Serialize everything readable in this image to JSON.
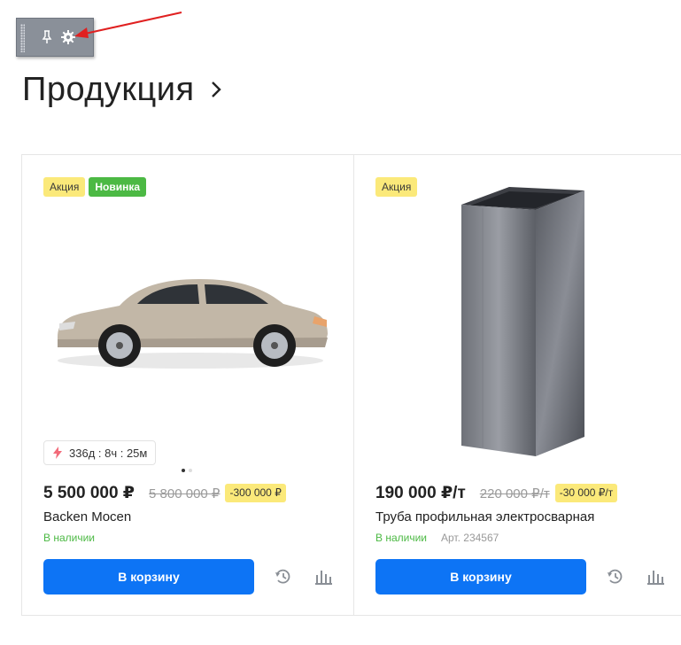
{
  "page": {
    "title": "Продукция"
  },
  "toolbar": {
    "icons": [
      "grip-handle",
      "pin-icon",
      "gear-icon",
      "caret-down-icon"
    ]
  },
  "colors": {
    "accent": "#0d74f5",
    "sale_badge": "#fbe97a",
    "new_badge": "#4cb944",
    "in_stock": "#4cb944",
    "toolbar_bg": "#8a9099",
    "annotation_arrow": "#e02020"
  },
  "products": [
    {
      "badges": {
        "sale": "Акция",
        "new": "Новинка"
      },
      "timer": "336д : 8ч : 25м",
      "price": "5 500 000 ₽",
      "old_price": "5 800 000 ₽",
      "discount": "-300 000 ₽",
      "title": "Backen Mocen",
      "stock": "В наличии",
      "buy_label": "В корзину",
      "image": "car-image",
      "gallery_dots": 2
    },
    {
      "badges": {
        "sale": "Акция"
      },
      "price": "190 000 ₽/т",
      "old_price": "220 000 ₽/т",
      "discount": "-30 000 ₽/т",
      "title": "Труба профильная электросварная",
      "stock": "В наличии",
      "article": "Арт. 234567",
      "buy_label": "В корзину",
      "image": "steel-pipe-image"
    }
  ]
}
